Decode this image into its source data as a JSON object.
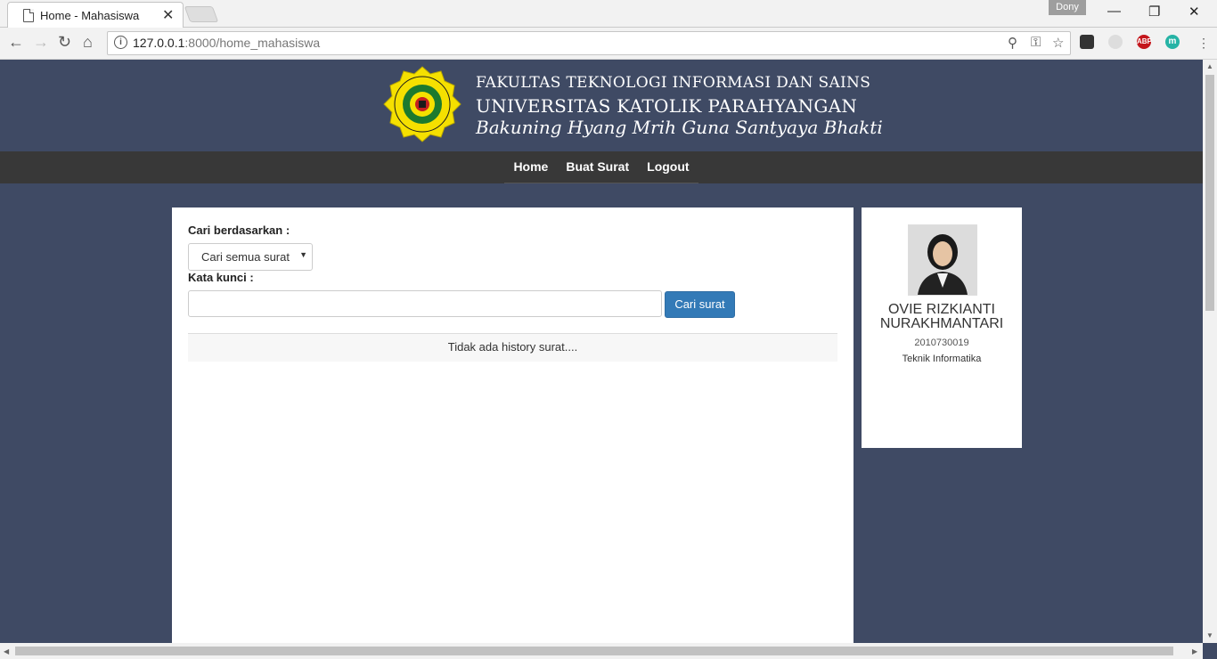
{
  "browser": {
    "tab_title": "Home - Mahasiswa",
    "tab_close": "✕",
    "user": "Dony",
    "url_host": "127.0.0.1",
    "url_path": ":8000/home_mahasiswa",
    "info": "i",
    "ext_abp": "ABP",
    "ext_m": "m"
  },
  "banner": {
    "line1": "FAKULTAS TEKNOLOGI INFORMASI DAN SAINS",
    "line2": "UNIVERSITAS KATOLIK PARAHYANGAN",
    "line3": "Bakuning Hyang Mrih Guna Santyaya Bhakti"
  },
  "menu": {
    "home": "Home",
    "buat_surat": "Buat Surat",
    "logout": "Logout"
  },
  "search": {
    "by_label": "Cari berdasarkan :",
    "by_value": "Cari semua surat",
    "keyword_label": "Kata kunci :",
    "keyword_value": "",
    "button": "Cari surat"
  },
  "history": {
    "empty": "Tidak ada history surat...."
  },
  "profile": {
    "name_line1": "OVIE RIZKIANTI",
    "name_line2": "NURAKHMANTARI",
    "npm": "2010730019",
    "jurusan": "Teknik Informatika"
  }
}
